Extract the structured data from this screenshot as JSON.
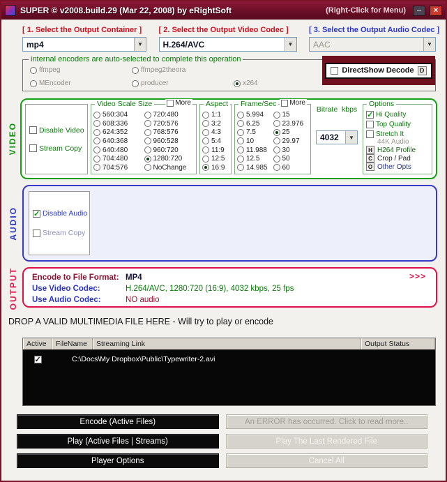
{
  "window": {
    "title": "SUPER © v2008.build.29 (Mar 22, 2008) by eRightSoft",
    "title_right": "(Right-Click for Menu)",
    "minimize": "–",
    "close": "×"
  },
  "selectors": {
    "container": {
      "label": "[ 1.   Select the Output Container ]",
      "value": "mp4"
    },
    "video": {
      "label": "[ 2.  Select the Output Video Codec ]",
      "value": "H.264/AVC"
    },
    "audio": {
      "label": "[ 3.  Select the Output Audio Codec ]",
      "value": "AAC"
    }
  },
  "encoders": {
    "legend": "internal encoders are auto-selected to complete this operation",
    "col1": [
      "ffmpeg",
      "MEncoder"
    ],
    "col2": [
      "ffmpeg2theora",
      "producer"
    ],
    "col3": [
      "x264"
    ],
    "selected": "x264",
    "directshow_label": "DirectShow Decode",
    "directshow_key": "D"
  },
  "video_section": {
    "side_label": "VIDEO",
    "disable_label": "Disable Video",
    "streamcopy_label": "Stream Copy",
    "scale": {
      "legend": "Video Scale Size",
      "more_label": "More",
      "col1": [
        "560:304",
        "608:336",
        "624:352",
        "640:368",
        "640:480",
        "704:480",
        "704:576"
      ],
      "col2": [
        "720:480",
        "720:576",
        "768:576",
        "960:528",
        "960:720",
        "1280:720",
        "NoChange"
      ],
      "selected": "1280:720"
    },
    "aspect": {
      "legend": "Aspect",
      "items": [
        "1:1",
        "3:2",
        "4:3",
        "5:4",
        "11:9",
        "12:5",
        "16:9"
      ],
      "selected": "16:9"
    },
    "fps": {
      "legend": "Frame/Sec",
      "more_label": "More",
      "col1": [
        "5.994",
        "6.25",
        "7.5",
        "10",
        "11.988",
        "12.5",
        "14.985"
      ],
      "col2": [
        "15",
        "23.976",
        "25",
        "29.97",
        "30",
        "50",
        "60"
      ],
      "selected": "25"
    },
    "bitrate": {
      "label": "Bitrate  kbps",
      "value": "4032"
    },
    "options": {
      "legend": "Options",
      "checks": [
        {
          "label": "Hi Quality",
          "checked": true
        },
        {
          "label": "Top Quality",
          "checked": false
        },
        {
          "label": "Stretch It",
          "checked": false
        }
      ],
      "muted": "44K Audio",
      "buttons": [
        {
          "key": "H",
          "label": "H264 Profile"
        },
        {
          "key": "C",
          "label": "Crop / Pad"
        },
        {
          "key": "O",
          "label": "Other Opts"
        }
      ]
    }
  },
  "audio_section": {
    "side_label": "AUDIO",
    "disable_label": "Disable Audio",
    "streamcopy_label": "Stream Copy"
  },
  "output_section": {
    "side_label": "OUTPUT",
    "rows": [
      {
        "label": "Encode to File Format:",
        "value": "MP4"
      },
      {
        "label": "Use Video Codec:",
        "value": "H.264/AVC,  1280:720 (16:9),  4032 kbps,  25 fps"
      },
      {
        "label": "Use Audio Codec:",
        "value": "NO audio"
      }
    ],
    "more_arrow": ">>>"
  },
  "drop_zone": {
    "text": "DROP A VALID MULTIMEDIA FILE HERE - Will try to play or encode"
  },
  "file_table": {
    "headers": [
      "Active",
      "FileName",
      "Streaming Link",
      "Output Status"
    ],
    "rows": [
      {
        "active": true,
        "path": "C:\\Docs\\My Dropbox\\Public\\Typewriter-2.avi",
        "status": ""
      }
    ]
  },
  "actions": {
    "encode": "Encode (Active Files)",
    "error": "An ERROR has occurred. Click to read more..",
    "play": "Play (Active Files | Streams)",
    "play_last": "Play The Last Rendered File",
    "player_options": "Player Options",
    "cancel_all": "Cancel All"
  }
}
